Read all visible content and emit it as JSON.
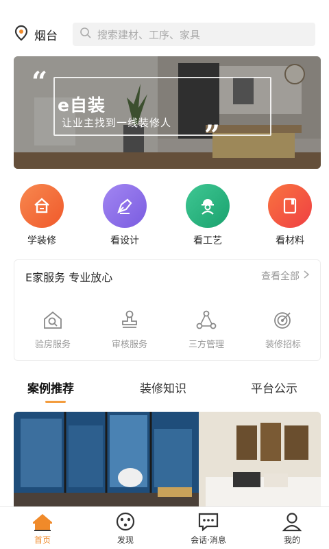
{
  "header": {
    "location_icon": "location-pin-icon",
    "city": "烟台",
    "search_icon": "search-icon",
    "search_placeholder": "搜索建材、工序、家具"
  },
  "banner": {
    "title": "e自装",
    "subtitle": "让业主找到一线装修人"
  },
  "quick_entries": [
    {
      "label": "学装修",
      "icon": "house-icon",
      "color": "#f26b3a"
    },
    {
      "label": "看设计",
      "icon": "pen-nib-icon",
      "color": "#8a6ce8"
    },
    {
      "label": "看工艺",
      "icon": "worker-icon",
      "color": "#22b37e"
    },
    {
      "label": "看材料",
      "icon": "material-book-icon",
      "color": "#f5533d"
    }
  ],
  "service": {
    "title": "E家服务  专业放心",
    "more_label": "查看全部",
    "items": [
      {
        "label": "验房服务",
        "icon": "house-inspect-icon"
      },
      {
        "label": "审核服务",
        "icon": "stamp-icon"
      },
      {
        "label": "三方管理",
        "icon": "triangle-nodes-icon"
      },
      {
        "label": "装修招标",
        "icon": "target-icon"
      }
    ]
  },
  "tabs": {
    "items": [
      "案例推荐",
      "装修知识",
      "平台公示"
    ],
    "active": "案例推荐"
  },
  "colors": {
    "accent": "#f39c3d",
    "nav_active": "#f08a2a"
  },
  "nav": {
    "items": [
      {
        "label": "首页",
        "icon": "home-icon"
      },
      {
        "label": "发现",
        "icon": "discover-icon"
      },
      {
        "label": "会话·消息",
        "icon": "chat-icon"
      },
      {
        "label": "我的",
        "icon": "user-icon"
      }
    ],
    "active": "首页"
  }
}
